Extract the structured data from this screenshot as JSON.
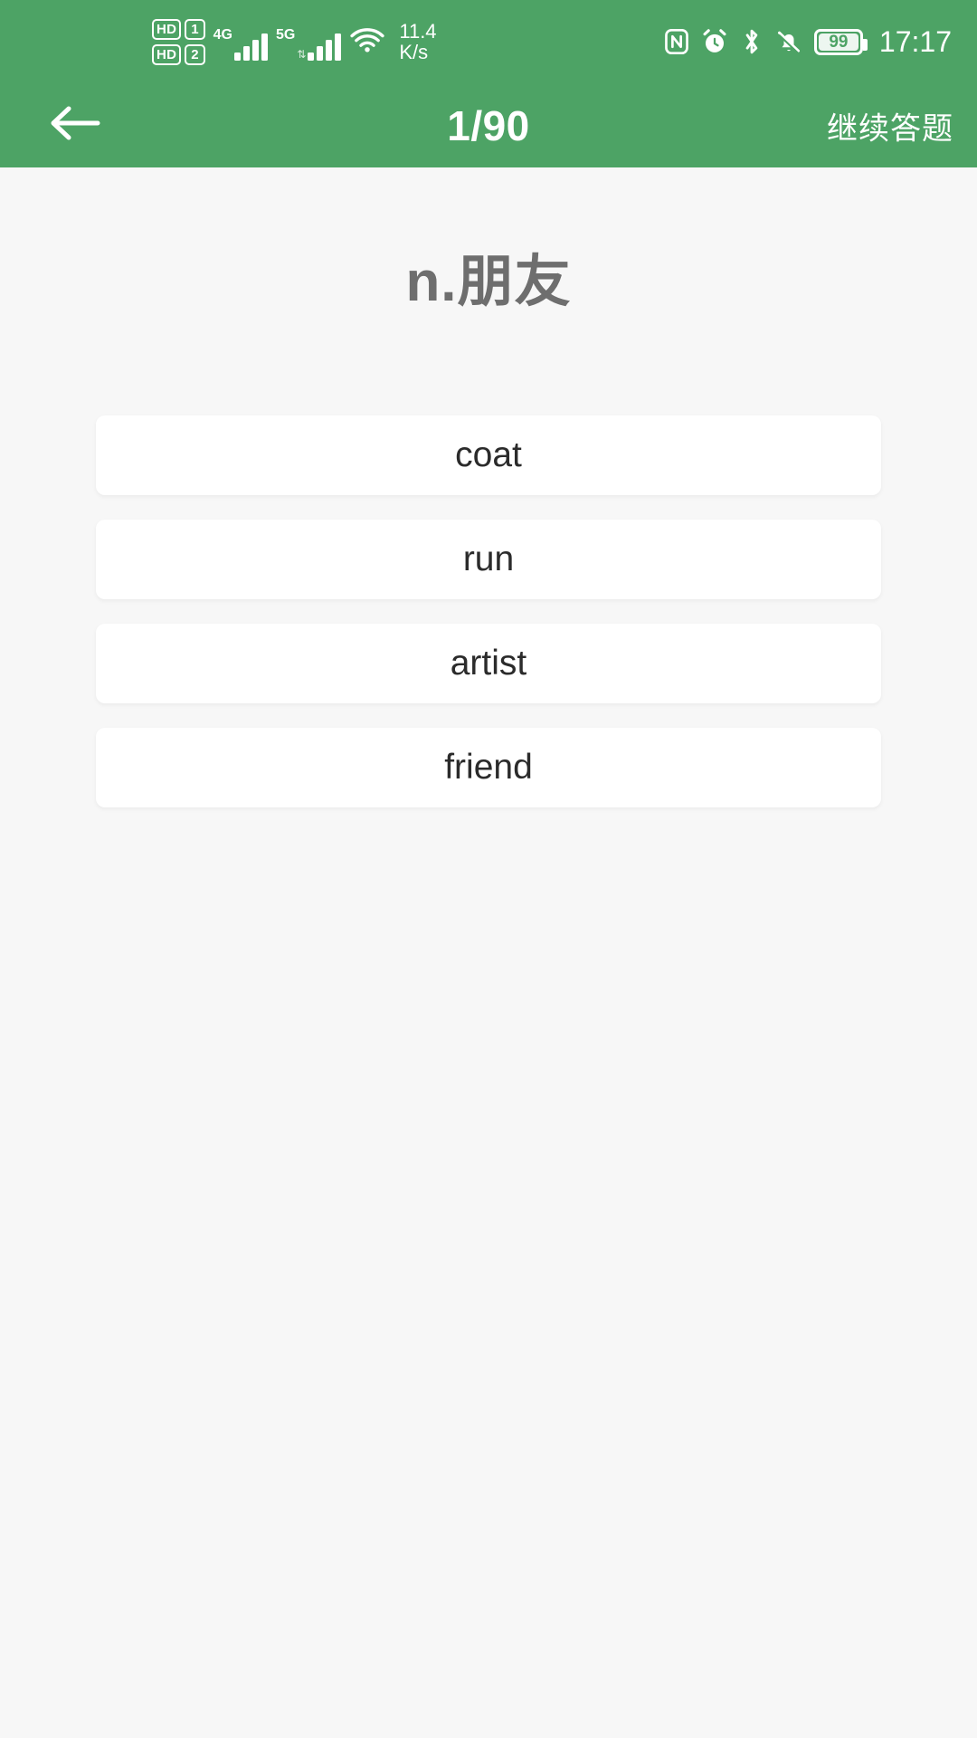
{
  "status_bar": {
    "volte": [
      {
        "label": "HD",
        "sim": "1"
      },
      {
        "label": "HD",
        "sim": "2"
      }
    ],
    "signals": [
      {
        "network": "4G",
        "bars": 4
      },
      {
        "network": "5G",
        "bars": 4
      }
    ],
    "wifi_icon": "wifi-icon",
    "network_speed_value": "11.4",
    "network_speed_unit": "K/s",
    "right_icons": [
      "nfc-icon",
      "alarm-clock-icon",
      "bluetooth-icon",
      "notifications-muted-icon"
    ],
    "battery_level": "99",
    "time": "17:17"
  },
  "header": {
    "back_icon": "back-arrow-icon",
    "title": "1/90",
    "action_label": "继续答题",
    "background_color": "#4da365"
  },
  "quiz": {
    "prompt": "n.朋友",
    "prompt_color": "#6e6e6e",
    "options": [
      {
        "text": "coat"
      },
      {
        "text": "run"
      },
      {
        "text": "artist"
      },
      {
        "text": "friend"
      }
    ]
  },
  "page_background": "#f7f7f7"
}
